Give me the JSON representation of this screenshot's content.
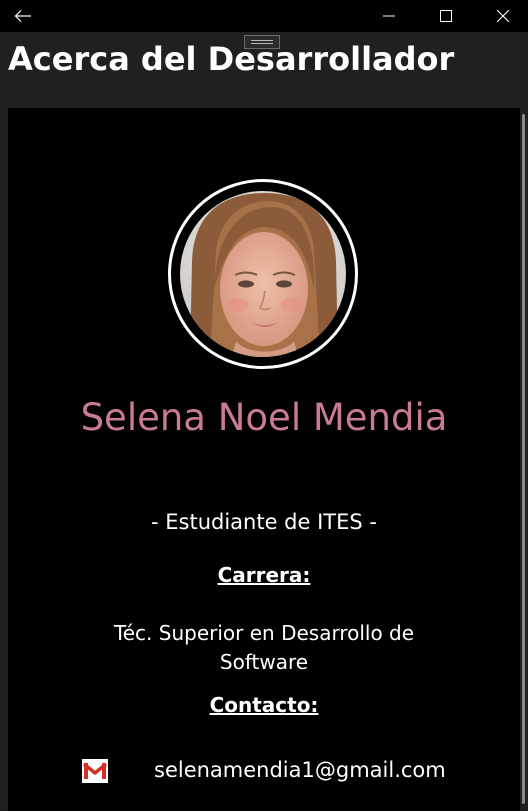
{
  "page": {
    "title": "Acerca del Desarrollador"
  },
  "profile": {
    "name": "Selena Noel Mendia",
    "role": "- Estudiante de ITES -",
    "career_label": "Carrera:",
    "career": "Téc. Superior en Desarrollo de Software",
    "contact_label": "Contacto:",
    "email": "selenamendia1@gmail.com"
  },
  "colors": {
    "name_accent": "#c97a95",
    "background": "#000000",
    "chrome": "#202020"
  },
  "icons": {
    "back": "arrow-left-icon",
    "minimize": "minimize-icon",
    "maximize": "maximize-icon",
    "close": "close-icon",
    "email": "gmail-icon"
  }
}
